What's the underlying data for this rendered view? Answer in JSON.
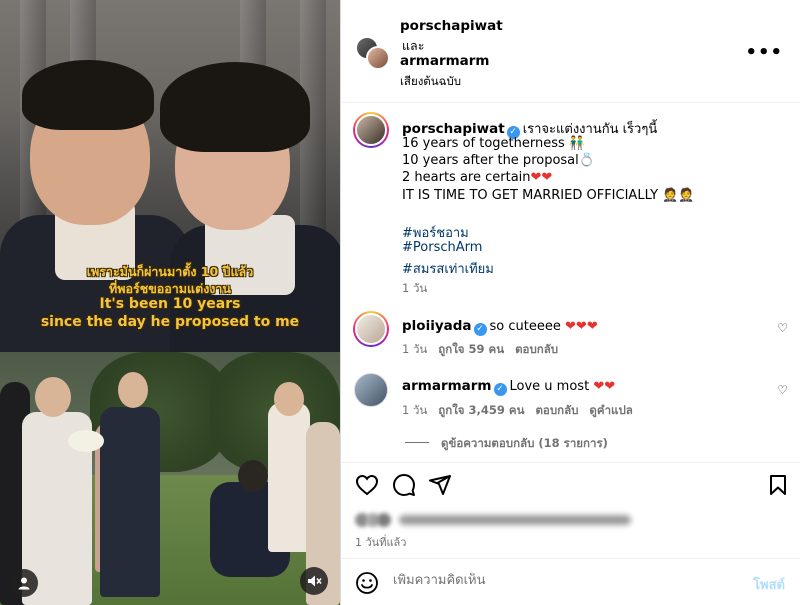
{
  "header": {
    "user1": "porschapiwat",
    "connector": "และ",
    "user2": "armarmarm",
    "audio": "เสียงต้นฉบับ",
    "more_icon": "more-options-icon"
  },
  "media": {
    "caption_th1": "เพราะมันก็ผ่านมาตั้ง 10 ปีแล้ว",
    "caption_th2": "ที่พอร์ชขออามแต่งงาน",
    "caption_en1": "It's been 10 years",
    "caption_en2": "since the day he proposed to me"
  },
  "post": {
    "username": "porschapiwat",
    "lines": [
      "เราจะแต่งงานกัน เร็วๆนี้",
      "16 years of togetherness 👬",
      "10 years after the proposal💍",
      "2 hearts are certain",
      "IT IS TIME TO GET MARRIED OFFICIALLY 🤵🤵"
    ],
    "hashtags": [
      "#พอร์ชอาม",
      "#PorschArm",
      "#สมรสเท่าเทียม"
    ],
    "time": "1 วัน"
  },
  "comments": [
    {
      "username": "ploiiyada",
      "text": "so cuteeee",
      "time": "1 วัน",
      "likes": "ถูกใจ 59 คน",
      "reply": "ตอบกลับ"
    },
    {
      "username": "armarmarm",
      "text": "Love u most",
      "time": "1 วัน",
      "likes": "ถูกใจ 3,459 คน",
      "reply": "ตอบกลับ",
      "translate": "ดูคำแปล"
    }
  ],
  "view_replies": "ดูข้อความตอบกลับ (18 รายการ)",
  "timestamp": "1 วันที่แล้ว",
  "comment_box": {
    "placeholder": "เพิ่มความคิดเห็น",
    "post_label": "โพสต์"
  },
  "colors": {
    "verified": "#3897f0",
    "hashtag": "#00376b",
    "caption": "#f4c542"
  }
}
